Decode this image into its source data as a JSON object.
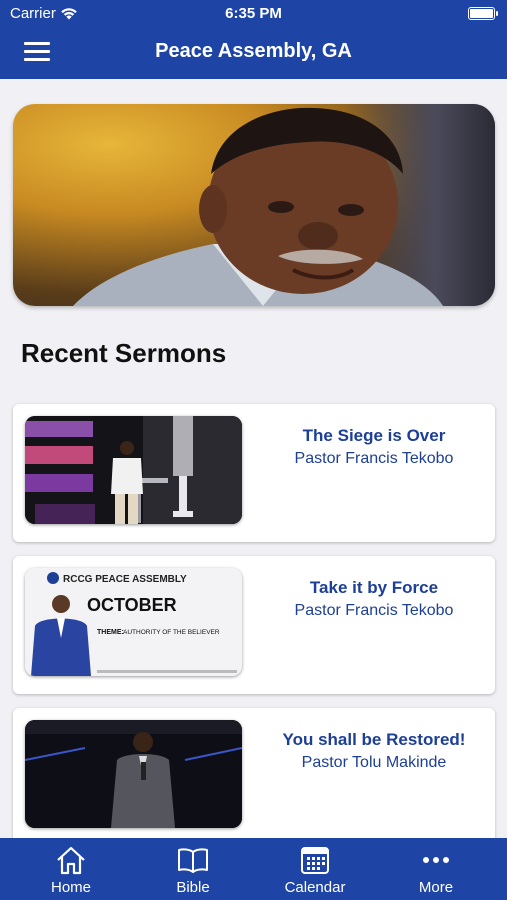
{
  "status_bar": {
    "carrier": "Carrier",
    "time": "6:35 PM"
  },
  "header": {
    "title": "Peace Assembly, GA"
  },
  "section": {
    "title": "Recent Sermons"
  },
  "sermons": [
    {
      "title": "The Siege is Over",
      "pastor": "Pastor Francis Tekobo"
    },
    {
      "title": "Take it by Force",
      "pastor": "Pastor Francis Tekobo",
      "thumb_text": {
        "org": "RCCG PEACE ASSEMBLY",
        "month": "OCTOBER",
        "theme_label": "THEME:",
        "theme": "AUTHORITY OF THE BELIEVER"
      }
    },
    {
      "title": "You shall be Restored!",
      "pastor": "Pastor Tolu Makinde"
    }
  ],
  "tabs": [
    {
      "label": "Home",
      "icon": "home-icon"
    },
    {
      "label": "Bible",
      "icon": "book-icon"
    },
    {
      "label": "Calendar",
      "icon": "calendar-icon"
    },
    {
      "label": "More",
      "icon": "more-icon"
    }
  ],
  "colors": {
    "primary": "#1e45a5",
    "link": "#1d3f96",
    "background": "#f1f1f5"
  }
}
